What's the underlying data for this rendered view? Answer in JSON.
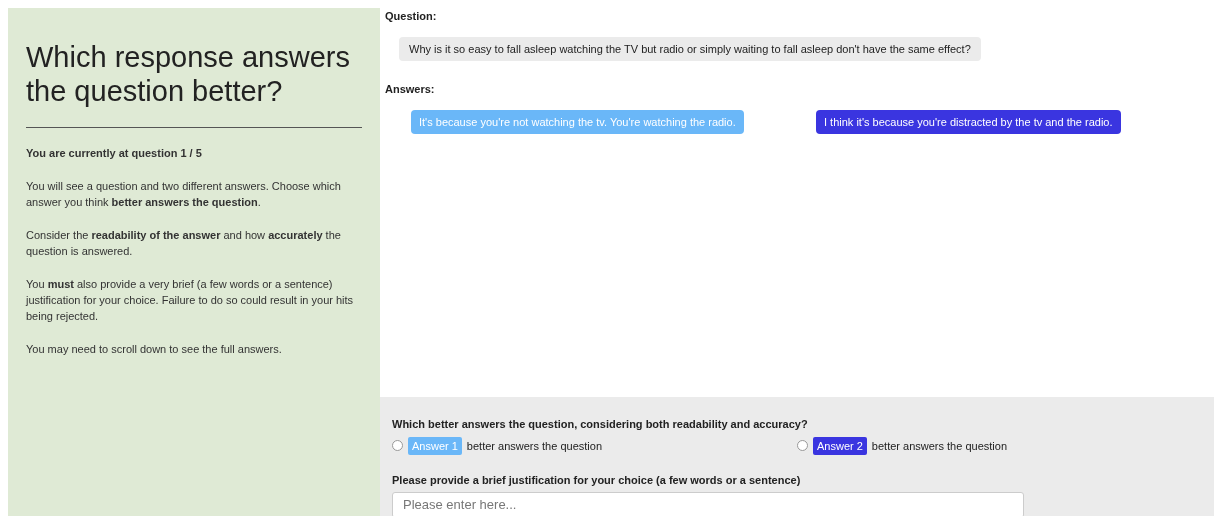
{
  "sidebar": {
    "title": "Which response answers the question better?",
    "paragraphs": [
      "**You are currently at question 1 / 5**",
      "You will see a question and two different answers. Choose which answer you think **better answers the question**.",
      "Consider the **readability of the answer** and how **accurately** the question is answered.",
      "You **must** also provide a very brief (a few words or a sentence) justification for your choice. Failure to do so could result in your hits being rejected.",
      "You may need to scroll down to see the full answers."
    ]
  },
  "question": {
    "label": "Question:",
    "text": "Why is it so easy to fall asleep watching the TV but radio or simply waiting to fall asleep don't have the same effect?"
  },
  "answers": {
    "label": "Answers:",
    "items": [
      {
        "text": "It's because you're not watching the tv. You're watching the radio.",
        "color": "#6ab7f8"
      },
      {
        "text": "I think it's because you're distracted by the tv and the radio.",
        "color": "#3a35e0"
      }
    ]
  },
  "choice": {
    "prompt": "Which better answers the question, considering both readability and accuracy?",
    "options": [
      {
        "badge": "Answer 1",
        "text": "better answers the question",
        "color": "#6ab7f8",
        "selected": false
      },
      {
        "badge": "Answer 2",
        "text": "better answers the question",
        "color": "#3a35e0",
        "selected": false
      }
    ]
  },
  "justification": {
    "label": "Please provide a brief justification for your choice (a few words or a sentence)",
    "placeholder": "Please enter here..."
  }
}
